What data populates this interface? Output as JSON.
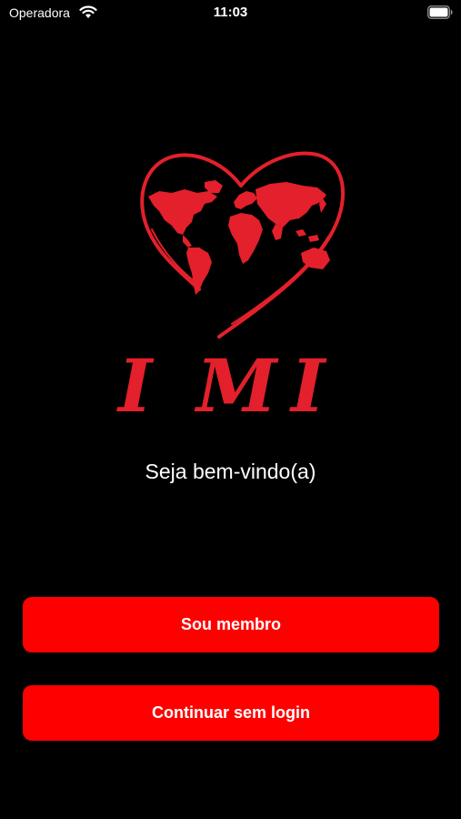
{
  "status_bar": {
    "carrier": "Operadora",
    "time": "11:03",
    "wifi_icon": "wifi-icon",
    "battery_icon": "battery-icon"
  },
  "logo": {
    "letters": [
      "I",
      "M",
      "I"
    ],
    "heart_icon": "heart-world-map-icon",
    "color": "#e3202b"
  },
  "welcome_text": "Seja bem-vindo(a)",
  "buttons": {
    "member_label": "Sou membro",
    "guest_label": "Continuar sem login",
    "color": "#ff0000"
  }
}
